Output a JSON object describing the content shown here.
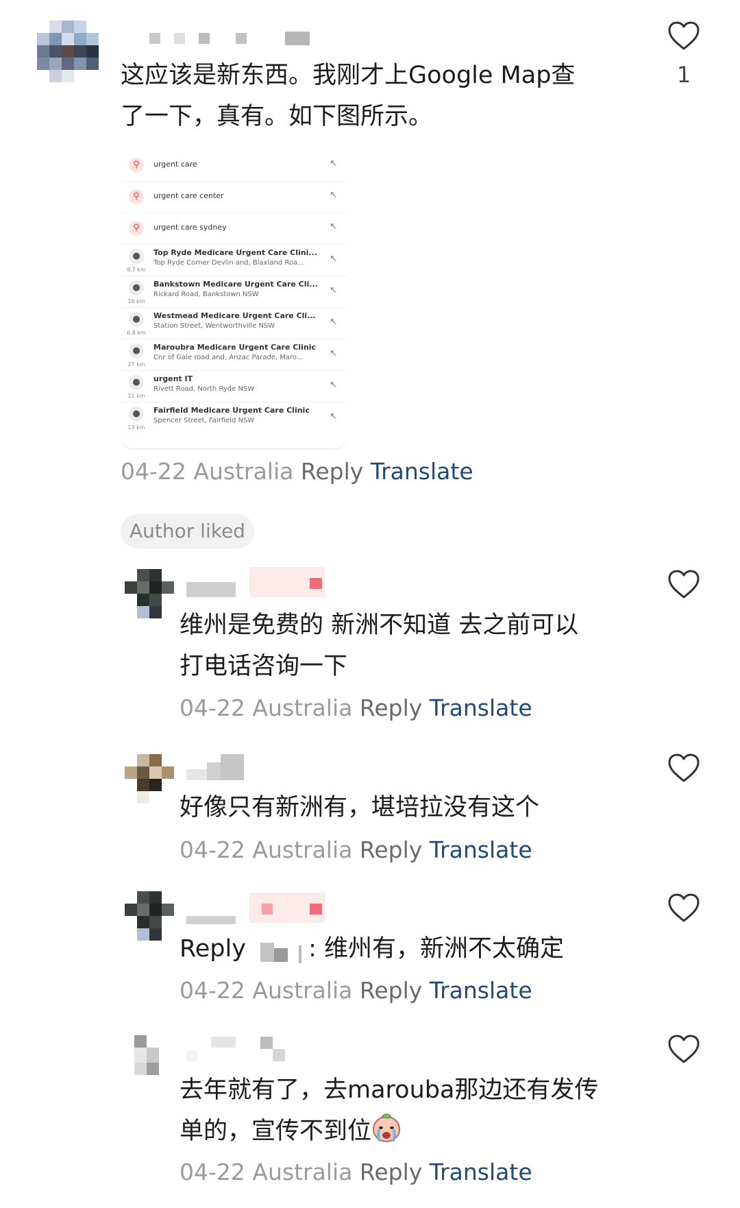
{
  "comments": [
    {
      "text_line1": "这应该是新东西。我刚才上Google Map查",
      "text_line2": "了一下，真有。如下图所示。",
      "like_count": "1",
      "meta": {
        "date": "04-22",
        "location": "Australia",
        "reply": "Reply",
        "translate": "Translate"
      }
    },
    {
      "text_line1": "维州是免费的 新洲不知道 去之前可以",
      "text_line2": "打电话咨询一下",
      "meta": {
        "date": "04-22",
        "location": "Australia",
        "reply": "Reply",
        "translate": "Translate"
      }
    },
    {
      "text_line1": "好像只有新洲有，堪培拉没有这个",
      "meta": {
        "date": "04-22",
        "location": "Australia",
        "reply": "Reply",
        "translate": "Translate"
      }
    },
    {
      "reply_prefix": "Reply",
      "text_line1": ": 维州有，新洲不太确定",
      "meta": {
        "date": "04-22",
        "location": "Australia",
        "reply": "Reply",
        "translate": "Translate"
      }
    },
    {
      "text_line1": "去年就有了，去marouba那边还有发传",
      "text_line2": "单的，宣传不到位",
      "emoji": "crying-face-emoji",
      "meta": {
        "date": "04-22",
        "location": "Australia",
        "reply": "Reply",
        "translate": "Translate"
      }
    }
  ],
  "author_liked": "Author liked",
  "embedded_search": {
    "suggestions": [
      {
        "text": "urgent care"
      },
      {
        "text": "urgent care center"
      },
      {
        "text": "urgent care sydney"
      }
    ],
    "places": [
      {
        "dist": "8.7 km",
        "name": "Top Ryde Medicare Urgent Care Clini...",
        "address": "Top Ryde Corner Devlin and, Blaxland Roa..."
      },
      {
        "dist": "16 km",
        "name": "Bankstown Medicare Urgent Care Cli...",
        "address": "Rickard Road, Bankstown NSW"
      },
      {
        "dist": "6.8 km",
        "name": "Westmead Medicare Urgent Care Cli...",
        "address": "Station Street, Wentworthville NSW"
      },
      {
        "dist": "27 km",
        "name": "Maroubra Medicare Urgent Care Clinic",
        "address": "Cnr of Gale road and, Anzac Parade, Maro..."
      },
      {
        "dist": "11 km",
        "name": "urgent IT",
        "address": "Rivett Road, North Ryde NSW"
      },
      {
        "dist": "13 km",
        "name": "Fairfield Medicare Urgent Care Clinic",
        "address": "Spencer Street, Fairfield NSW"
      }
    ]
  },
  "colors": {
    "translate": "#1f4a78",
    "meta_gray": "#9a9a9a",
    "search_accent": "#e04545"
  }
}
